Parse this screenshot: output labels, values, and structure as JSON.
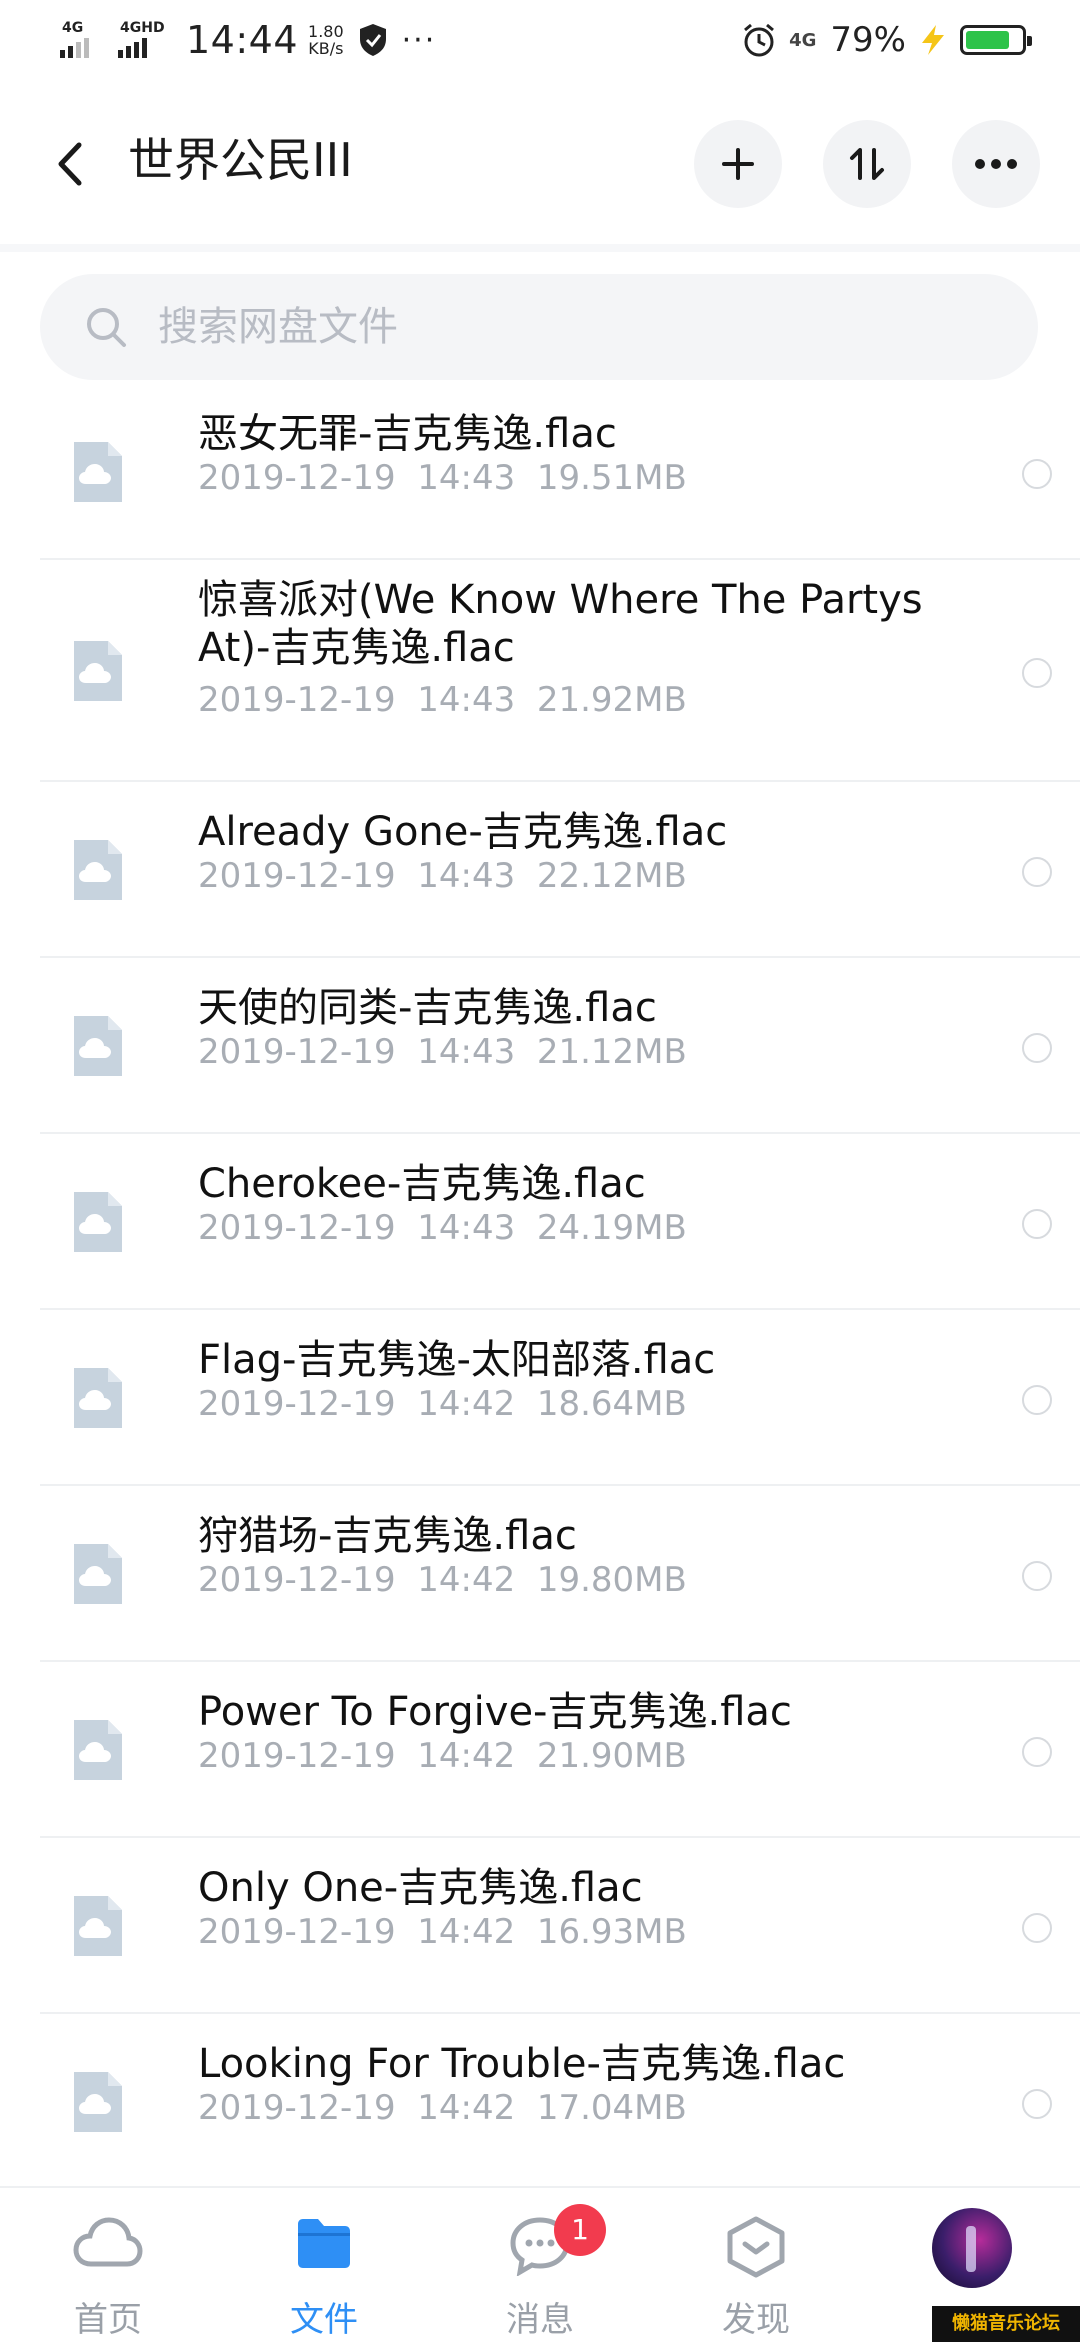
{
  "status_bar": {
    "sim1_label": "4G",
    "sim2_label": "4GHD",
    "time": "14:44",
    "speed_value": "1.80",
    "speed_unit": "KB/s",
    "more_glyph": "···",
    "network_label": "4G",
    "battery_percent": "79%",
    "battery_level": 0.79,
    "battery_color": "#2ec34a",
    "charging_color": "#f5c518"
  },
  "header": {
    "title": "世界公民III",
    "back_icon": "chevron-left-icon",
    "actions": [
      "plus-icon",
      "sort-icon",
      "more-icon"
    ]
  },
  "search": {
    "placeholder": "搜索网盘文件",
    "value": ""
  },
  "files": [
    {
      "name": "恶女无罪-吉克隽逸.flac",
      "date": "2019-12-19",
      "time": "14:43",
      "size": "19.51MB"
    },
    {
      "name": "惊喜派对(We Know Where The Partys At)-吉克隽逸.flac",
      "date": "2019-12-19",
      "time": "14:43",
      "size": "21.92MB"
    },
    {
      "name": "Already Gone-吉克隽逸.flac",
      "date": "2019-12-19",
      "time": "14:43",
      "size": "22.12MB"
    },
    {
      "name": "天使的同类-吉克隽逸.flac",
      "date": "2019-12-19",
      "time": "14:43",
      "size": "21.12MB"
    },
    {
      "name": "Cherokee-吉克隽逸.flac",
      "date": "2019-12-19",
      "time": "14:43",
      "size": "24.19MB"
    },
    {
      "name": "Flag-吉克隽逸-太阳部落.flac",
      "date": "2019-12-19",
      "time": "14:42",
      "size": "18.64MB"
    },
    {
      "name": "狩猎场-吉克隽逸.flac",
      "date": "2019-12-19",
      "time": "14:42",
      "size": "19.80MB"
    },
    {
      "name": "Power To Forgive-吉克隽逸.flac",
      "date": "2019-12-19",
      "time": "14:42",
      "size": "21.90MB"
    },
    {
      "name": "Only One-吉克隽逸.flac",
      "date": "2019-12-19",
      "time": "14:42",
      "size": "16.93MB"
    },
    {
      "name": "Looking For Trouble-吉克隽逸.flac",
      "date": "2019-12-19",
      "time": "14:42",
      "size": "17.04MB"
    }
  ],
  "bottom_nav": {
    "items": [
      {
        "label": "首页",
        "icon": "cloud-icon",
        "active": false
      },
      {
        "label": "文件",
        "icon": "folder-icon",
        "active": true
      },
      {
        "label": "消息",
        "icon": "chat-icon",
        "active": false,
        "badge": "1"
      },
      {
        "label": "发现",
        "icon": "discover-icon",
        "active": false
      }
    ],
    "accent_color": "#2e8ff5",
    "badge_color": "#f23b4e"
  },
  "watermark": "懒猫音乐论坛"
}
